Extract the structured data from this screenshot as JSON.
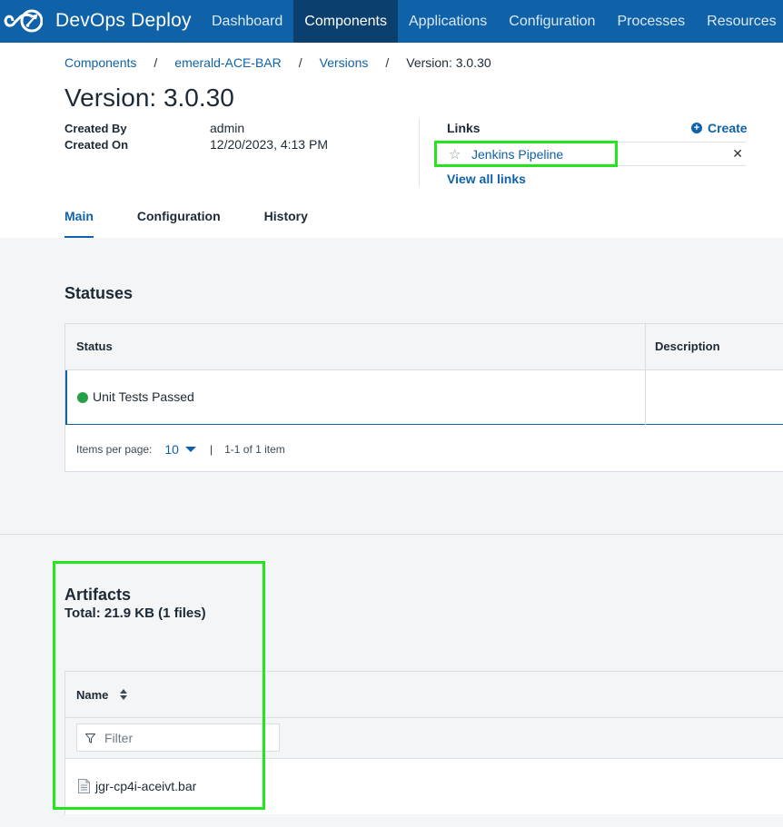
{
  "header": {
    "brand": "DevOps Deploy",
    "logo_icon": "devops-infinity-rocket-logo",
    "nav": [
      {
        "label": "Dashboard",
        "active": false
      },
      {
        "label": "Components",
        "active": true
      },
      {
        "label": "Applications",
        "active": false
      },
      {
        "label": "Configuration",
        "active": false
      },
      {
        "label": "Processes",
        "active": false
      },
      {
        "label": "Resources",
        "active": false
      }
    ],
    "bar_color": "#0f62a8",
    "active_color": "#0a3f6e"
  },
  "breadcrumb": {
    "items": [
      "Components",
      "emerald-ACE-BAR",
      "Versions"
    ],
    "separator": "/",
    "current": "Version: 3.0.30"
  },
  "page": {
    "title": "Version: 3.0.30",
    "created_by_label": "Created By",
    "created_by_value": "admin",
    "created_on_label": "Created On",
    "created_on_value": "12/20/2023, 4:13 PM"
  },
  "links": {
    "title": "Links",
    "create_label": "Create",
    "items": [
      {
        "label": "Jenkins Pipeline",
        "icon": "star-outline-icon"
      }
    ],
    "view_all_label": "View all links"
  },
  "tabs": [
    {
      "label": "Main",
      "active": true
    },
    {
      "label": "Configuration",
      "active": false
    },
    {
      "label": "History",
      "active": false
    }
  ],
  "statuses": {
    "title": "Statuses",
    "columns": [
      "Status",
      "Description"
    ],
    "rows": [
      {
        "status": "Unit Tests Passed",
        "status_color": "#24a148",
        "description": ""
      }
    ],
    "pager": {
      "items_per_page_label": "Items per page:",
      "items_per_page_value": "10",
      "range_text": "1-1 of 1 item"
    }
  },
  "artifacts": {
    "title": "Artifacts",
    "total": "Total: 21.9 KB (1 files)",
    "columns": [
      "Name"
    ],
    "filter_placeholder": "Filter",
    "rows": [
      {
        "name": "jgr-cp4i-aceivt.bar",
        "icon": "file-icon"
      }
    ]
  },
  "highlight_color": "#22e51c"
}
